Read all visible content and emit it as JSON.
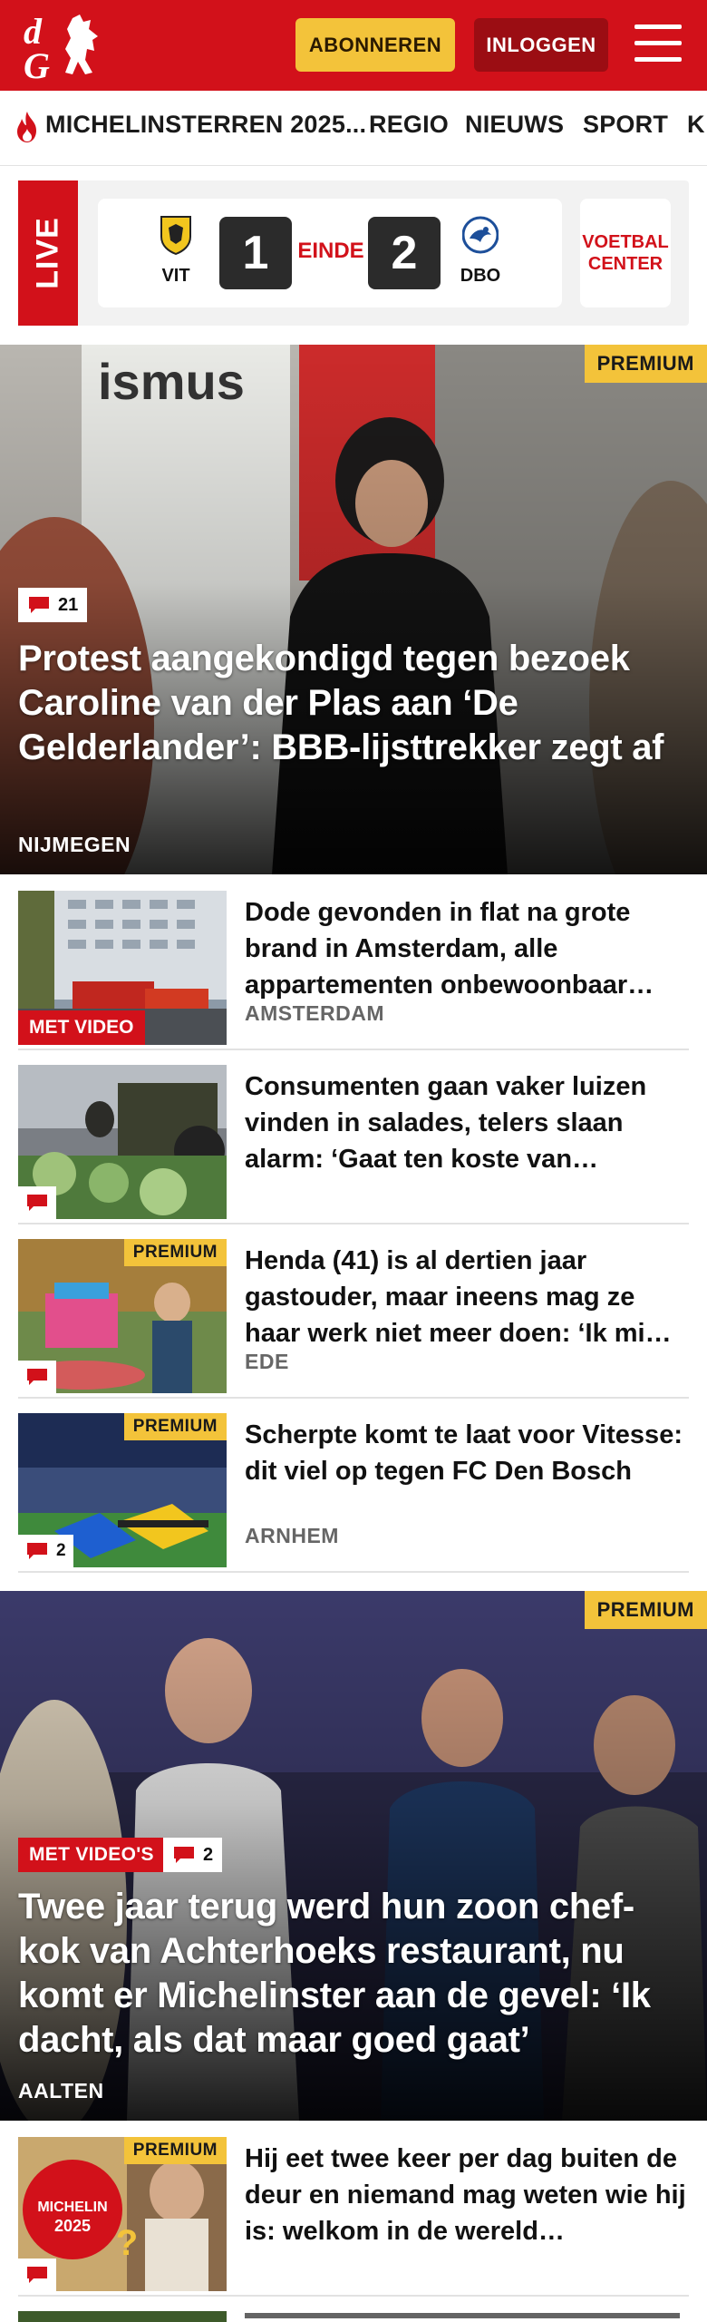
{
  "header": {
    "logo_text": "dG",
    "subscribe_label": "ABONNEREN",
    "login_label": "INLOGGEN",
    "brand_color": "#d2111a",
    "accent_color": "#f3c33a"
  },
  "nav": {
    "items": [
      {
        "label": "MICHELINSTERREN 2025..."
      },
      {
        "label": "REGIO"
      },
      {
        "label": "NIEUWS"
      },
      {
        "label": "SPORT"
      },
      {
        "label": "K"
      }
    ]
  },
  "live": {
    "tag": "LIVE",
    "home": {
      "abbr": "VIT",
      "score": "1"
    },
    "status": "EINDE",
    "away": {
      "abbr": "DBO",
      "score": "2"
    },
    "voetbal_center": "VOETBAL CENTER"
  },
  "hero1": {
    "premium": "PREMIUM",
    "comments": "21",
    "title": "Protest aangekondigd tegen bezoek Caroline van der Plas aan ‘De Gelderlander’: BBB-lijsttrekker zegt af",
    "location": "NIJMEGEN"
  },
  "articles": [
    {
      "title": "Dode gevonden in flat na grote brand in Amsterdam, alle appartementen onbewoonbaar…",
      "location": "AMSTERDAM",
      "badge": "MET VIDEO"
    },
    {
      "title": "Consumenten gaan vaker luizen vinden in salades, telers slaan alarm: ‘Gaat ten koste van…",
      "location": "",
      "comments": ""
    },
    {
      "title": "Henda (41) is al dertien jaar gastouder, maar ineens mag ze haar werk niet meer doen: ‘Ik mi…",
      "location": "EDE",
      "premium": "PREMIUM",
      "comments": ""
    },
    {
      "title": "Scherpte komt te laat voor Vitesse: dit viel op tegen FC Den Bosch",
      "location": "ARNHEM",
      "premium": "PREMIUM",
      "comments": "2"
    }
  ],
  "hero2": {
    "premium": "PREMIUM",
    "badge": "MET VIDEO'S",
    "comments": "2",
    "title": "Twee jaar terug werd hun zoon chef-kok van Achterhoeks restaurant, nu komt er Michelinster aan de gevel: ‘Ik dacht, als dat maar goed gaat’",
    "location": "AALTEN"
  },
  "article5": {
    "premium": "PREMIUM",
    "thumb_text_1": "MICHELIN",
    "thumb_text_2": "2025",
    "title": "Hij eet twee keer per dag buiten de deur en niemand mag weten wie hij is: welkom in de wereld…",
    "comments": ""
  }
}
